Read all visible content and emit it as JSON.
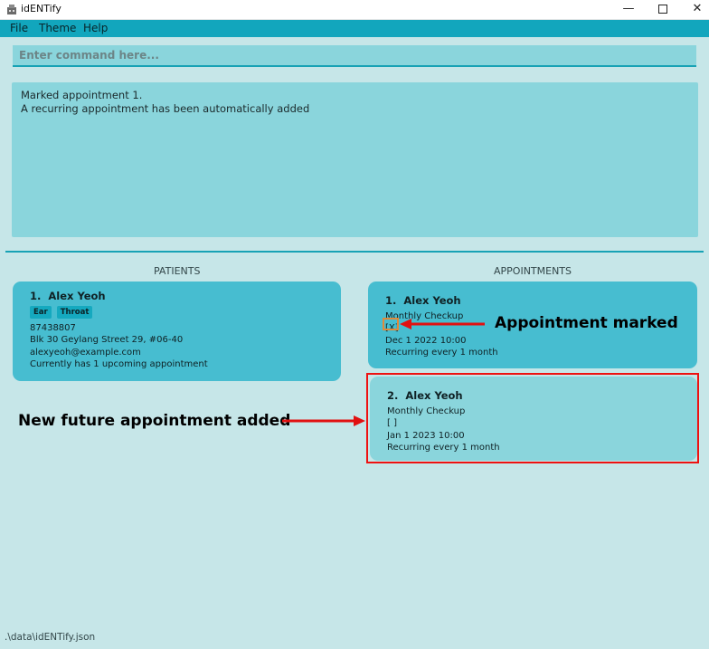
{
  "window": {
    "title": "idENTify"
  },
  "menu": [
    "File",
    "Theme",
    "Help"
  ],
  "command": {
    "placeholder": "Enter command here...",
    "value": ""
  },
  "result": {
    "line1": "Marked appointment 1.",
    "line2": "A recurring appointment has been automatically added"
  },
  "patients": {
    "header": "PATIENTS",
    "items": [
      {
        "index": "1.",
        "name": "Alex Yeoh",
        "tags": [
          "Ear",
          "Throat"
        ],
        "phone": "87438807",
        "address": "Blk 30 Geylang Street 29, #06-40",
        "email": "alexyeoh@example.com",
        "note": "Currently has 1 upcoming appointment"
      }
    ]
  },
  "appointments": {
    "header": "APPOINTMENTS",
    "items": [
      {
        "index": "1.",
        "name": "Alex Yeoh",
        "reason": "Monthly Checkup",
        "status": "[X]",
        "datetime": "Dec 1 2022 10:00",
        "recurrence": "Recurring every 1 month"
      },
      {
        "index": "2.",
        "name": "Alex Yeoh",
        "reason": "Monthly Checkup",
        "status": "[ ]",
        "datetime": "Jan 1 2023 10:00",
        "recurrence": "Recurring every 1 month"
      }
    ]
  },
  "annotations": {
    "marked": "Appointment  marked",
    "added": "New future appointment  added"
  },
  "status_bar": ".\\data\\idENTify.json",
  "colors": {
    "background": "#c6e6e8",
    "menubar": "#12a6bd",
    "card_dark": "#47bdd0",
    "card_light": "#8ad5dc",
    "annotation": "#e11111"
  }
}
